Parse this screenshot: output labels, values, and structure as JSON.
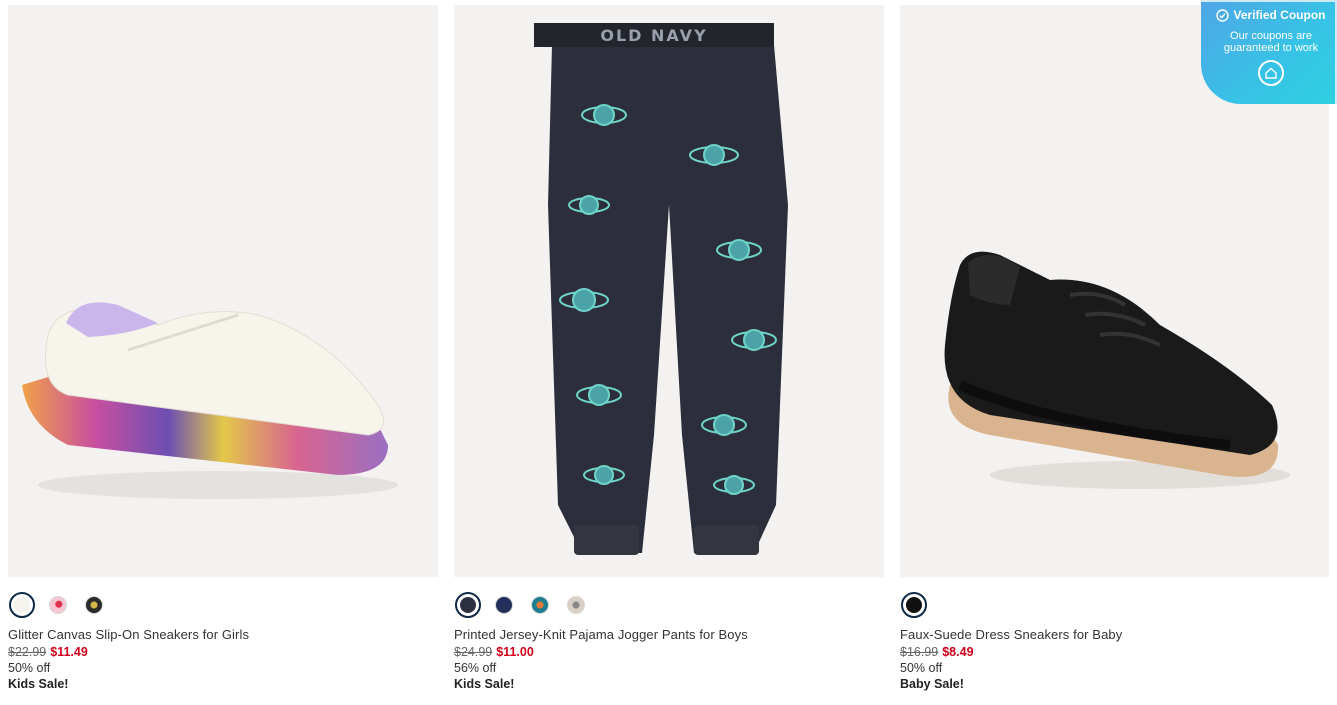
{
  "products": [
    {
      "title": "Glitter Canvas Slip-On Sneakers for Girls",
      "was_price": "$22.99",
      "sale_price": "$11.49",
      "discount": "50% off",
      "promo": "Kids Sale!",
      "swatch_colors": [
        "#f5f3ee",
        "#f4b8c8",
        "#2a2a2a"
      ]
    },
    {
      "title": "Printed Jersey-Knit Pajama Jogger Pants for Boys",
      "was_price": "$24.99",
      "sale_price": "$11.00",
      "discount": "56% off",
      "promo": "Kids Sale!",
      "brand_waistband": "OLD NAVY",
      "swatch_colors": [
        "#2c3040",
        "#25305a",
        "#1e7d8f",
        "#d9cfc4"
      ]
    },
    {
      "title": "Faux-Suede Dress Sneakers for Baby",
      "was_price": "$16.99",
      "sale_price": "$8.49",
      "discount": "50% off",
      "promo": "Baby Sale!",
      "swatch_colors": [
        "#111111"
      ]
    }
  ],
  "coupon": {
    "title": "Verified Coupon",
    "subtitle": "Our coupons are guaranteed to work"
  },
  "colors": {
    "sale_red": "#d0021b",
    "selected_ring": "#0e2a47",
    "coupon_gradient_start": "#4fa6e6",
    "coupon_gradient_end": "#2fd0e0"
  }
}
